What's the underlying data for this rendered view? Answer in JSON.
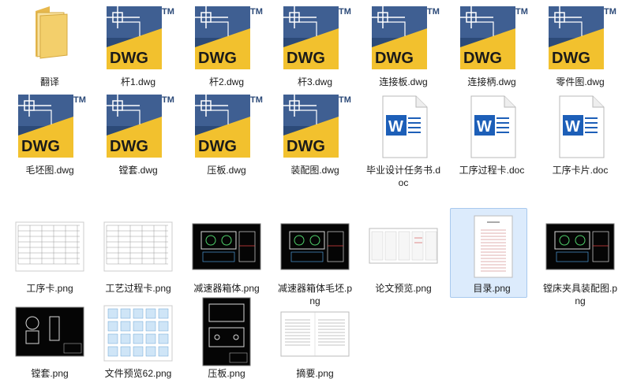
{
  "files": [
    {
      "name": "翻译",
      "type": "folder"
    },
    {
      "name": "杆1.dwg",
      "type": "dwg"
    },
    {
      "name": "杆2.dwg",
      "type": "dwg"
    },
    {
      "name": "杆3.dwg",
      "type": "dwg"
    },
    {
      "name": "连接板.dwg",
      "type": "dwg"
    },
    {
      "name": "连接柄.dwg",
      "type": "dwg"
    },
    {
      "name": "零件图.dwg",
      "type": "dwg"
    },
    {
      "name": "毛坯图.dwg",
      "type": "dwg"
    },
    {
      "name": "镗套.dwg",
      "type": "dwg"
    },
    {
      "name": "压板.dwg",
      "type": "dwg"
    },
    {
      "name": "装配图.dwg",
      "type": "dwg"
    },
    {
      "name": "毕业设计任务书.doc",
      "type": "doc"
    },
    {
      "name": "工序过程卡.doc",
      "type": "doc"
    },
    {
      "name": "工序卡片.doc",
      "type": "doc"
    },
    {
      "name": "工序卡.png",
      "type": "png-table"
    },
    {
      "name": "工艺过程卡.png",
      "type": "png-table"
    },
    {
      "name": "减速器箱体.png",
      "type": "png-cad-dark"
    },
    {
      "name": "减速器箱体毛坯.png",
      "type": "png-cad-dark"
    },
    {
      "name": "论文预览.png",
      "type": "png-pages"
    },
    {
      "name": "目录.png",
      "type": "png-doc",
      "selected": true
    },
    {
      "name": "镗床夹具装配图.png",
      "type": "png-cad-dark"
    },
    {
      "name": "镗套.png",
      "type": "png-cad-dark-small"
    },
    {
      "name": "文件预览62.png",
      "type": "png-grid"
    },
    {
      "name": "压板.png",
      "type": "png-cad-portrait"
    },
    {
      "name": "摘要.png",
      "type": "png-text"
    }
  ],
  "icons": {
    "dwg_text": "DWG",
    "tm_text": "TM",
    "word_letter": "W"
  },
  "colors": {
    "dwg_blue": "#2c4a78",
    "dwg_yellow": "#f2c12e",
    "word_blue": "#1d5fb8",
    "folder": "#f3cf6b",
    "selection": "#dcebfc"
  }
}
